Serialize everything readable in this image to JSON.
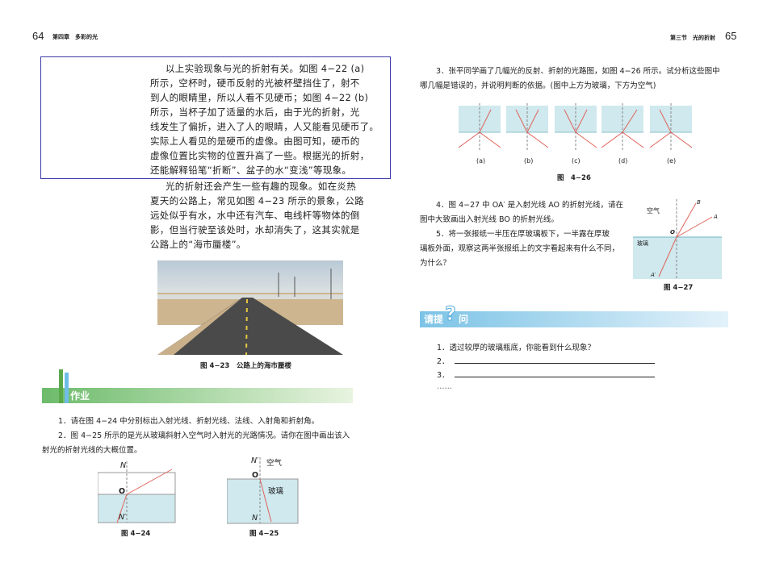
{
  "left_page": {
    "page_number": "64",
    "chapter": "第四章　多彩的光",
    "para1": [
      "以上实验现象与光的折射有关。如图 4−22 (a)",
      "所示，空杯时，硬币反射的光被杯壁挡住了，射不",
      "到人的眼睛里，所以人看不见硬币；如图 4−22 (b)",
      "所示，当杯子加了适量的水后，由于光的折射，光",
      "线发生了偏折，进入了人的眼睛，人又能看见硬币了。",
      "实际上人看见的是硬币的虚像。由图可知，硬币的",
      "虚像位置比实物的位置升高了一些。根据光的折射，",
      "还能解释铅笔“折断”、盆子的水“变浅”等现象。"
    ],
    "para2": [
      "光的折射还会产生一些有趣的现象。如在炎热",
      "夏天的公路上，常见如图 4−23 所示的景象，公路",
      "远处似乎有水，水中还有汽车、电线杆等物体的倒",
      "影，但当行驶至该处时，水却消失了，这其实就是",
      "公路上的“海市蜃楼”。"
    ],
    "photo_caption": "图 4−23　公路上的海市蜃楼",
    "homework_title": "作业",
    "homework": [
      "1．请在图 4−24 中分别标出入射光线、折射光线、法线、入射角和折射角。",
      "2．图 4−25 所示的是光从玻璃斜射入空气时入射光的光路情况。请你在图中画出该入",
      "射光的折射光线的大概位置。"
    ],
    "fig24": {
      "caption": "图 4−24",
      "N": "N",
      "O": "O",
      "N2": "N′"
    },
    "fig25": {
      "caption": "图 4−25",
      "N2": "N′",
      "air": "空气",
      "O": "O",
      "glass": "玻璃",
      "N": "N"
    }
  },
  "right_page": {
    "page_number": "65",
    "section": "第三节　光的折射",
    "q3": [
      "3．张平同学画了几幅光的反射、折射的光路图，如图 4−26 所示。试分析这些图中",
      "哪几幅是错误的，并说明判断的依据。(图中上方为玻璃，下方为空气)"
    ],
    "fig26": {
      "labels": [
        "(a)",
        "(b)",
        "(c)",
        "(d)",
        "(e)"
      ],
      "caption": "图　4−26"
    },
    "q4": [
      "4．图 4−27 中 OA′ 是入射光线 AO 的折射光线，请在",
      "图中大致画出入射光线 BO 的折射光线。"
    ],
    "q5": [
      "5．将一张报纸一半压在厚玻璃板下，一半露在厚玻",
      "璃板外面，观察这两半张报纸上的文字看起来有什么不同，",
      "为什么？"
    ],
    "fig27": {
      "caption": "图 4−27",
      "air": "空气",
      "glass": "玻璃",
      "B": "B",
      "A": "A",
      "O": "O",
      "A2": "A′"
    },
    "ask_title_1": "请提",
    "ask_title_q": "?",
    "ask_title_2": "问",
    "ask": {
      "q1": "1．透过较厚的玻璃瓶底，你能看到什么现象？",
      "q2": "2．",
      "q3": "3．",
      "more": "……"
    }
  },
  "colors": {
    "ray": "#e0625a",
    "glass": "#cfe9ee",
    "highlight_box": "#3a3aa8",
    "homework_green": "#6dbb6b",
    "ask_blue": "#7cc3e6"
  }
}
